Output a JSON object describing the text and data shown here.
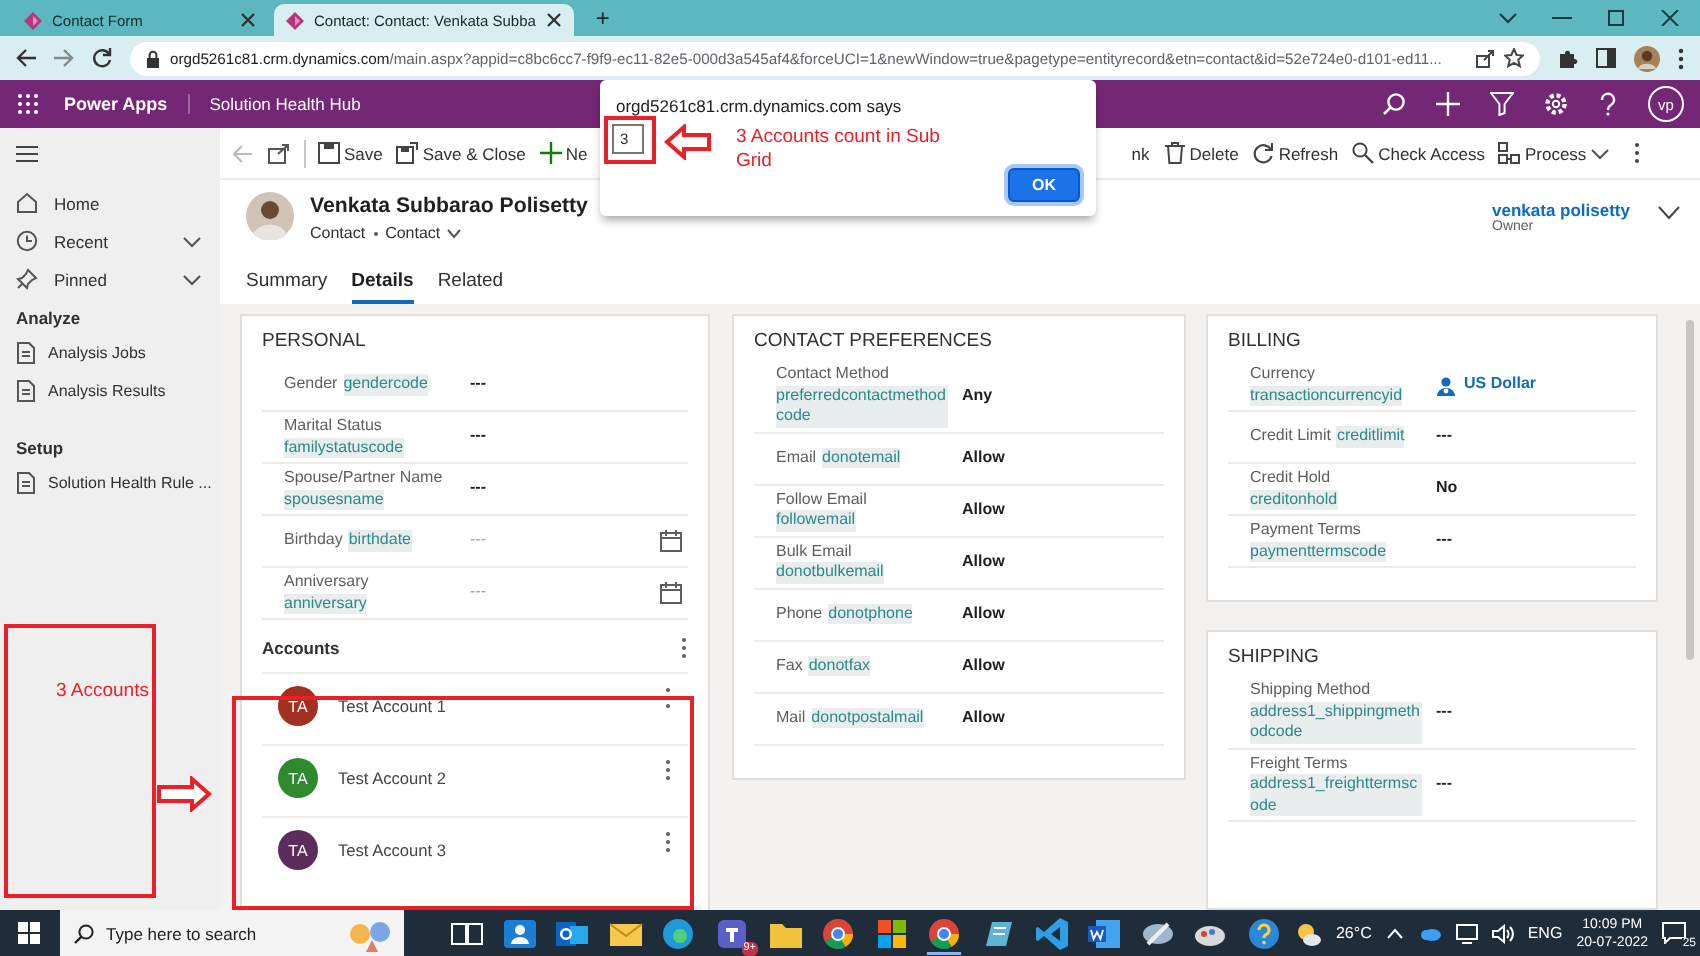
{
  "browser": {
    "tabs": [
      {
        "title": "Contact Form",
        "selected": false
      },
      {
        "title": "Contact: Contact: Venkata Subba",
        "selected": true
      }
    ],
    "new_tab": "+",
    "url_host": "orgd5261c81.crm.dynamics.com",
    "url_path": "/main.aspx?appid=c8bc6cc7-f9f9-ec11-82e5-000d3a545af4&forceUCI=1&newWindow=true&pagetype=entityrecord&etn=contact&id=52e724e0-d101-ed11..."
  },
  "app_bar": {
    "app": "Power Apps",
    "area": "Solution Health Hub",
    "avatar": "vp"
  },
  "sidebar": {
    "nav": [
      {
        "label": "Home",
        "kind": "link"
      },
      {
        "label": "Recent",
        "kind": "expander"
      },
      {
        "label": "Pinned",
        "kind": "expander"
      }
    ],
    "groups": [
      {
        "title": "Analyze",
        "items": [
          "Analysis Jobs",
          "Analysis Results"
        ]
      },
      {
        "title": "Setup",
        "items": [
          "Solution Health Rule ..."
        ]
      }
    ]
  },
  "command_bar": [
    "Save",
    "Save & Close",
    "Ne",
    "nk",
    "Delete",
    "Refresh",
    "Check Access",
    "Process"
  ],
  "record": {
    "name": "Venkata Subbarao Polisetty",
    "entity": "Contact",
    "form": "Contact",
    "owner": "venkata polisetty",
    "owner_label": "Owner"
  },
  "tabs": [
    {
      "label": "Summary",
      "selected": false
    },
    {
      "label": "Details",
      "selected": true
    },
    {
      "label": "Related",
      "selected": false
    }
  ],
  "personal": {
    "title": "PERSONAL",
    "fields": [
      {
        "label": "Gender",
        "field": "gendercode",
        "value": "---",
        "kind": "text"
      },
      {
        "label": "Marital Status",
        "field": "familystatuscode",
        "value": "---",
        "kind": "text"
      },
      {
        "label": "Spouse/Partner Name",
        "field": "spousesname",
        "value": "---",
        "kind": "text"
      },
      {
        "label": "Birthday",
        "field": "birthdate",
        "placeholder": "---",
        "kind": "date"
      },
      {
        "label": "Anniversary",
        "field": "anniversary",
        "placeholder": "---",
        "kind": "date"
      }
    ],
    "subgrid": {
      "title": "Accounts",
      "rows": [
        {
          "initials": "TA",
          "name": "Test Account 1",
          "color": "#a1301f"
        },
        {
          "initials": "TA",
          "name": "Test Account 2",
          "color": "#2f8a2f"
        },
        {
          "initials": "TA",
          "name": "Test Account 3",
          "color": "#5c2d5c"
        }
      ]
    }
  },
  "contact_preferences": {
    "title": "CONTACT PREFERENCES",
    "fields": [
      {
        "label": "Contact Method",
        "field": "preferredcontactmethodcode",
        "value": "Any",
        "kind": "text"
      },
      {
        "label": "Email",
        "field": "donotemail",
        "value": "Allow",
        "kind": "text"
      },
      {
        "label": "Follow Email",
        "field": "followemail",
        "value": "Allow",
        "kind": "text"
      },
      {
        "label": "Bulk Email",
        "field": "donotbulkemail",
        "value": "Allow",
        "kind": "text"
      },
      {
        "label": "Phone",
        "field": "donotphone",
        "value": "Allow",
        "kind": "text"
      },
      {
        "label": "Fax",
        "field": "donotfax",
        "value": "Allow",
        "kind": "text"
      },
      {
        "label": "Mail",
        "field": "donotpostalmail",
        "value": "Allow",
        "kind": "text"
      }
    ]
  },
  "billing": {
    "title": "BILLING",
    "fields": [
      {
        "label": "Currency",
        "field": "transactioncurrencyid",
        "value": "US Dollar",
        "kind": "lookup"
      },
      {
        "label": "Credit Limit",
        "field": "creditlimit",
        "value": "---",
        "kind": "text"
      },
      {
        "label": "Credit Hold",
        "field": "creditonhold",
        "value": "No",
        "kind": "text"
      },
      {
        "label": "Payment Terms",
        "field": "paymenttermscode",
        "value": "---",
        "kind": "text"
      }
    ]
  },
  "shipping": {
    "title": "SHIPPING",
    "fields": [
      {
        "label": "Shipping Method",
        "field": "address1_shippingmethodcode",
        "value": "---",
        "kind": "text"
      },
      {
        "label": "Freight Terms",
        "field": "address1_freighttermscode",
        "value": "---",
        "kind": "text"
      }
    ]
  },
  "dialog": {
    "title": "orgd5261c81.crm.dynamics.com says",
    "value": "3",
    "button": "OK"
  },
  "annotations": {
    "dialog_note": "3 Accounts count in Sub Grid",
    "side_note": "3 Accounts"
  },
  "taskbar": {
    "search_placeholder": "Type here to search",
    "chat_badge": "9+",
    "weather": "26°C",
    "language": "ENG",
    "time": "10:09 PM",
    "date": "20-07-2022",
    "notifications": "25"
  }
}
